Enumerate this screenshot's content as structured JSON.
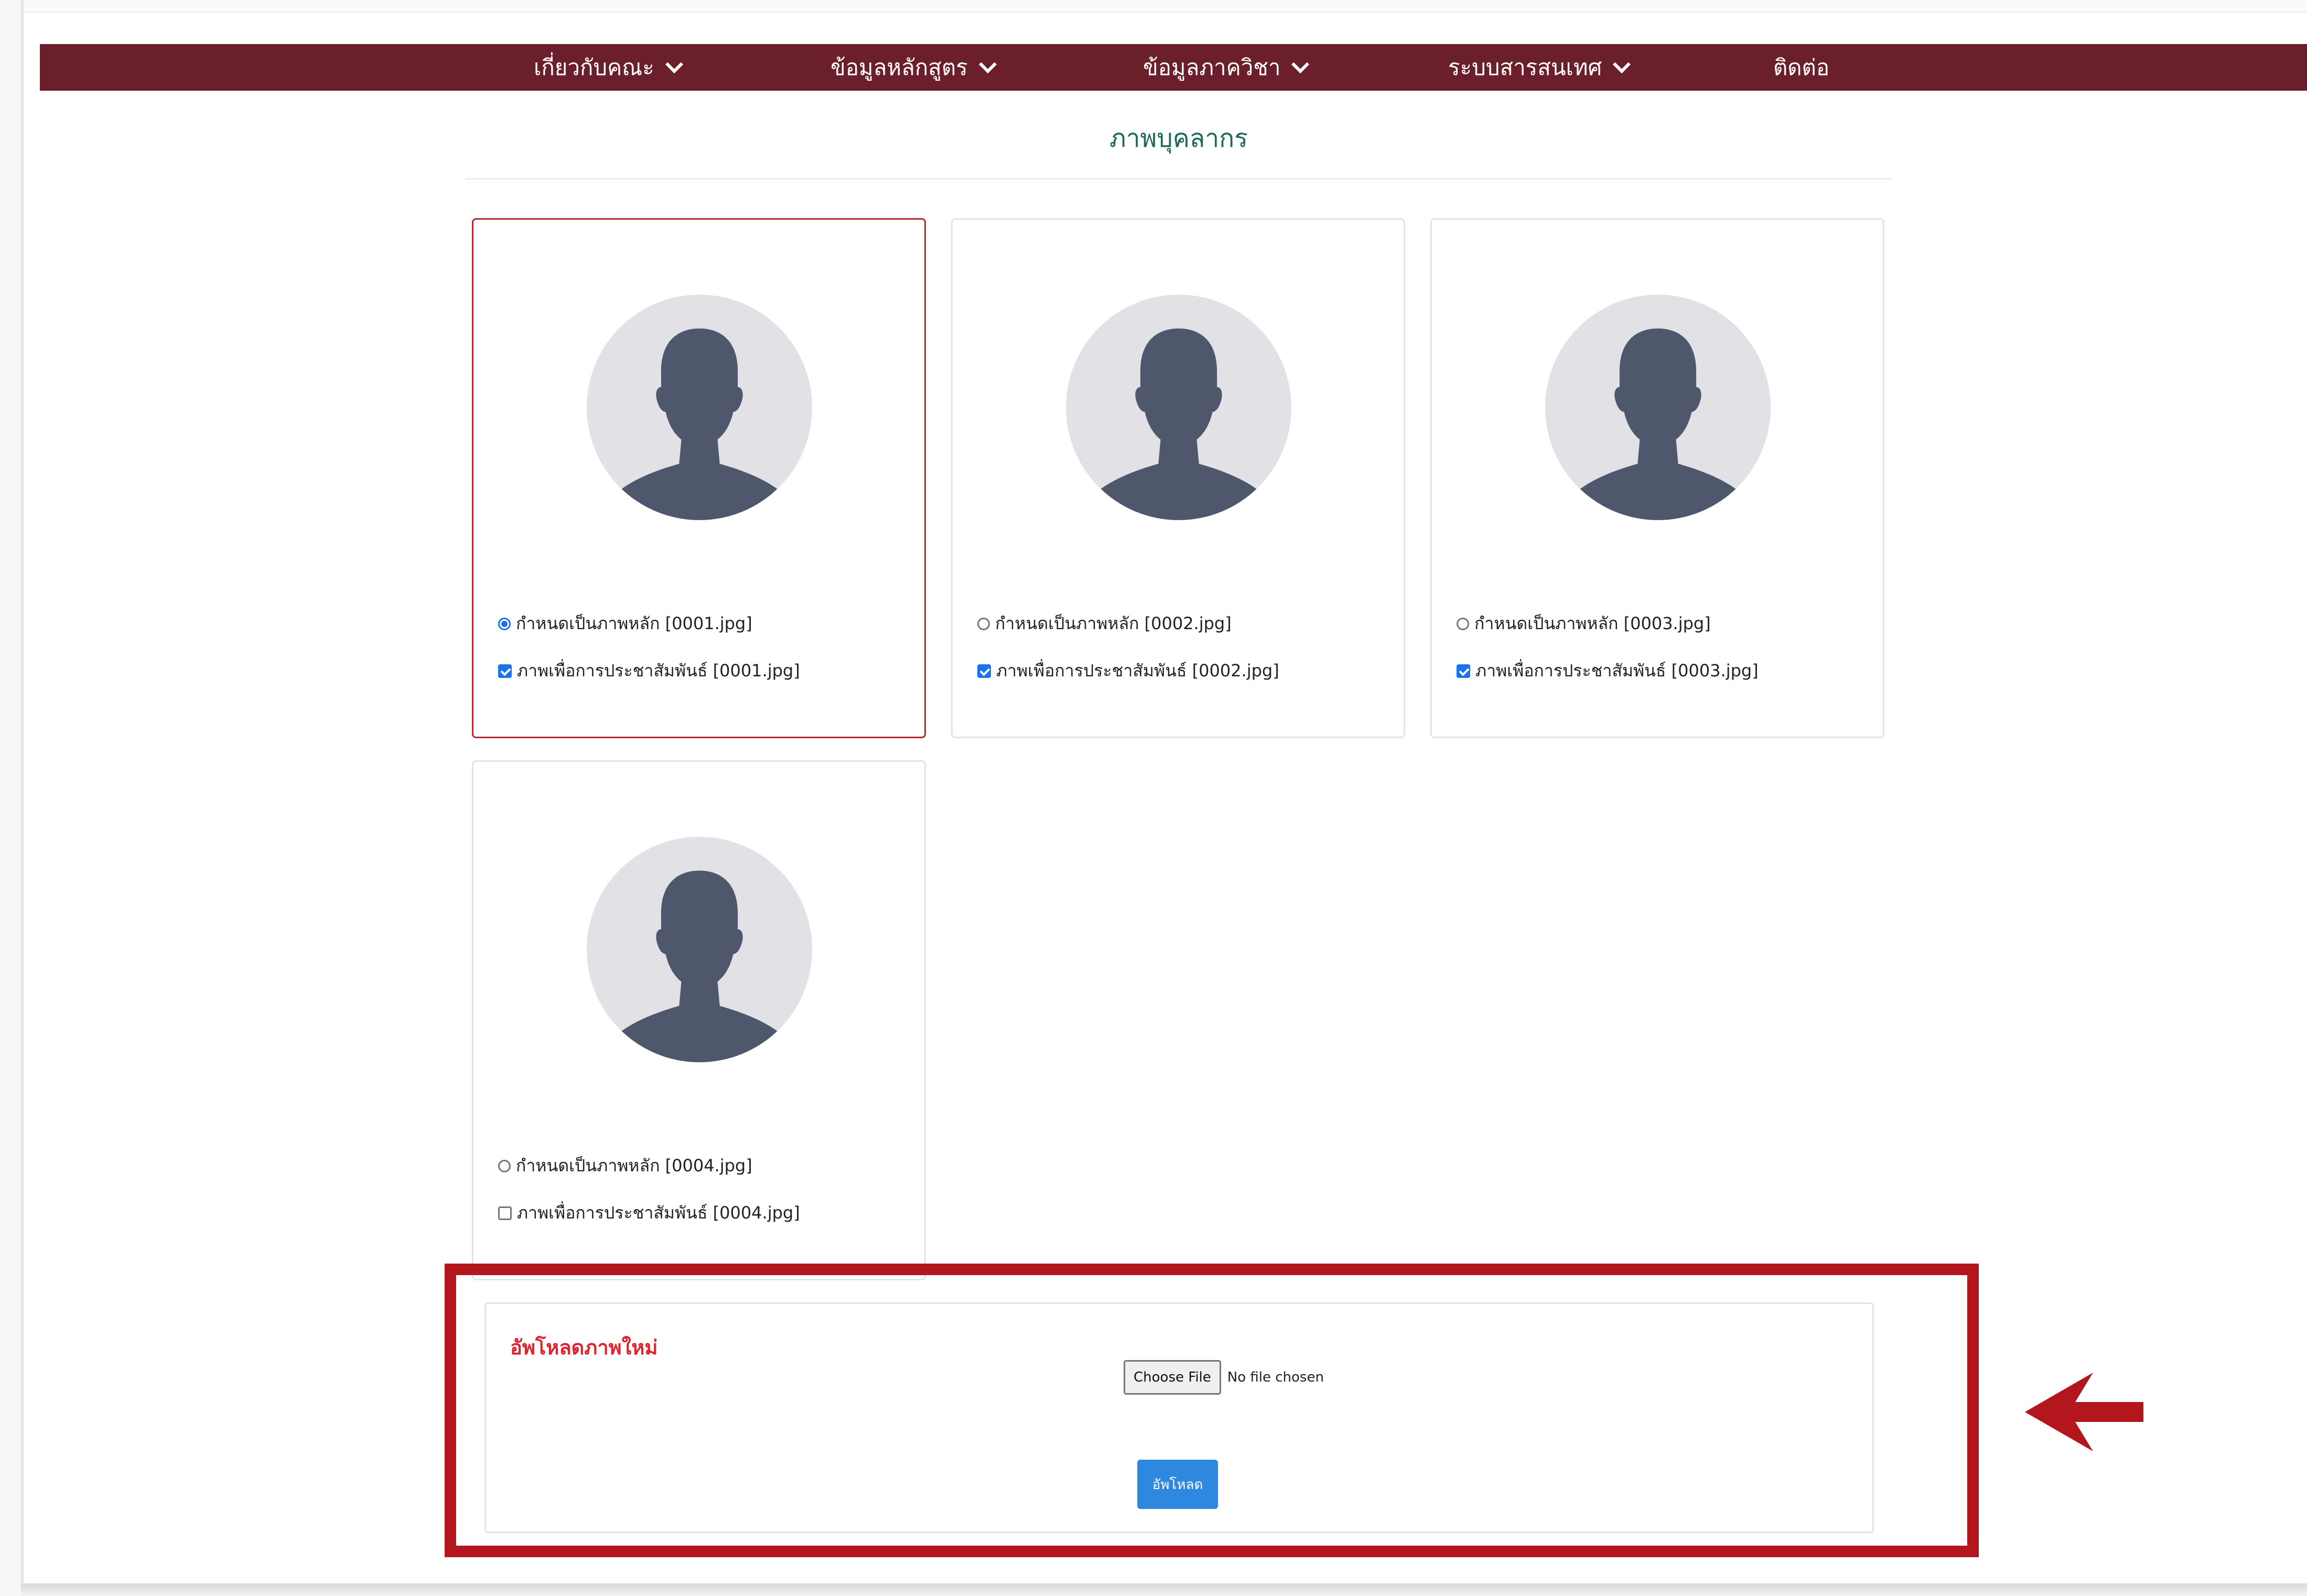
{
  "nav": {
    "items": [
      {
        "label": "เกี่ยวกับคณะ",
        "dropdown": true
      },
      {
        "label": "ข้อมูลหลักสูตร",
        "dropdown": true
      },
      {
        "label": "ข้อมูลภาควิชา",
        "dropdown": true
      },
      {
        "label": "ระบบสารสนเทศ",
        "dropdown": true
      },
      {
        "label": "ติดต่อ",
        "dropdown": false
      }
    ]
  },
  "page": {
    "title": "ภาพบุคลากร"
  },
  "photos": [
    {
      "main_label": "กำหนดเป็นภาพหลัก [0001.jpg]",
      "pr_label": "ภาพเพื่อการประชาสัมพันธ์ [0001.jpg]",
      "is_main": true,
      "is_pr": true
    },
    {
      "main_label": "กำหนดเป็นภาพหลัก [0002.jpg]",
      "pr_label": "ภาพเพื่อการประชาสัมพันธ์ [0002.jpg]",
      "is_main": false,
      "is_pr": true
    },
    {
      "main_label": "กำหนดเป็นภาพหลัก [0003.jpg]",
      "pr_label": "ภาพเพื่อการประชาสัมพันธ์ [0003.jpg]",
      "is_main": false,
      "is_pr": true
    },
    {
      "main_label": "กำหนดเป็นภาพหลัก [0004.jpg]",
      "pr_label": "ภาพเพื่อการประชาสัมพันธ์ [0004.jpg]",
      "is_main": false,
      "is_pr": false
    }
  ],
  "upload": {
    "label": "อัพโหลดภาพใหม่",
    "file_button": "Choose File",
    "file_status": "No file chosen",
    "submit_label": "อัพโหลด"
  },
  "colors": {
    "navbar": "#6b1f2a",
    "title": "#1f6a5a",
    "selected_card_border": "#b52a35",
    "highlight_annotation": "#b3161c",
    "upload_label": "#e0242e",
    "upload_button": "#2f88df",
    "avatar_bg": "#e2e2e6",
    "avatar_figure": "#4f576d"
  },
  "icons": {
    "nav_dropdown": "chevron-down-icon",
    "avatar": "user-silhouette-icon",
    "annotation": "left-arrow-icon"
  }
}
